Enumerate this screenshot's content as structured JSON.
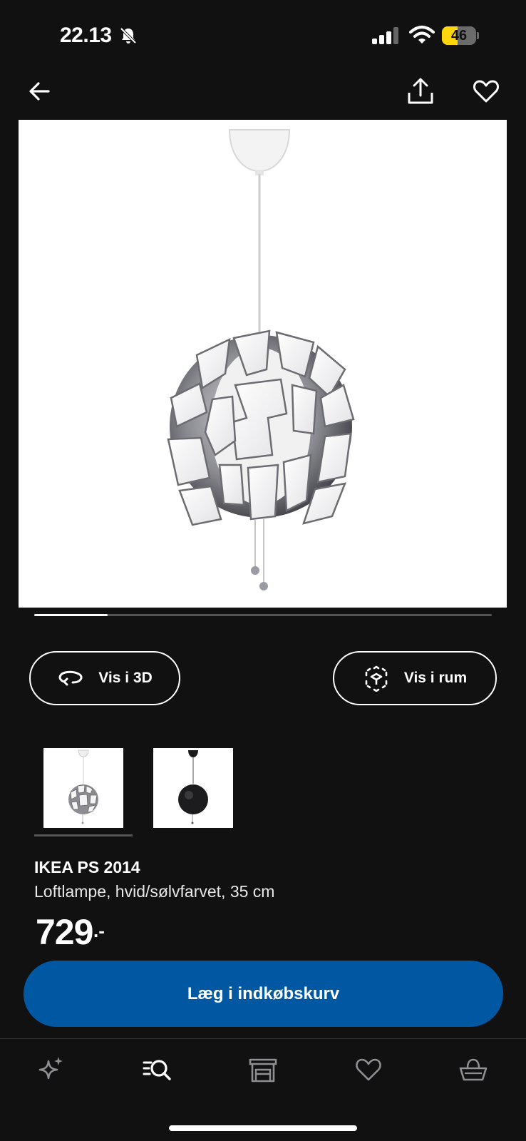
{
  "status_bar": {
    "time": "22.13",
    "battery": "46",
    "battery_level": 0.46,
    "icons": [
      "bell-slash-icon",
      "signal-icon",
      "wifi-icon",
      "battery-icon"
    ]
  },
  "nav": {
    "icons": [
      "arrow-left-icon",
      "share-icon",
      "heart-icon"
    ]
  },
  "gallery": {
    "image_position": 0.16,
    "thumbnails": [
      "white-lamp-thumbnail",
      "black-lamp-thumbnail"
    ]
  },
  "actions": {
    "view_3d": "Vis i 3D",
    "view_in_room": "Vis i rum"
  },
  "product": {
    "name": "IKEA PS 2014",
    "description": "Loftlampe, hvid/sølvfarvet, 35 cm",
    "price": "729",
    "price_suffix": ".-"
  },
  "cart": {
    "button_label": "Læg i indkøbskurv"
  },
  "tabbar": {
    "tabs": [
      "sparkle-icon",
      "search-list-icon",
      "store-icon",
      "heart-icon",
      "basket-icon"
    ],
    "active_index": 1
  },
  "colors": {
    "background": "#111111",
    "accent": "#0058a3",
    "battery": "#ffd60a"
  }
}
